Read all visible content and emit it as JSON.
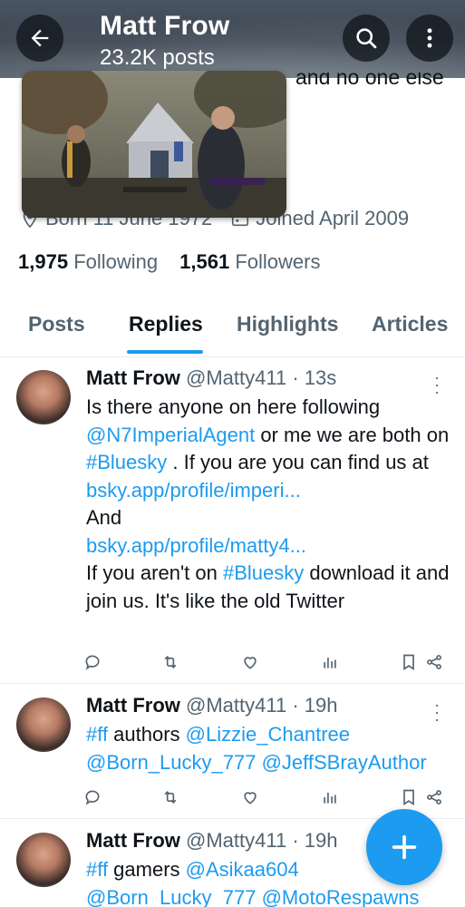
{
  "header": {
    "title": "Matt Frow",
    "post_count": "23.2K posts"
  },
  "bio": {
    "partial_line": "and no one else",
    "born": "Born 11 June 1972",
    "joined": "Joined April 2009"
  },
  "stats": {
    "following_count": "1,975",
    "following_label": "Following",
    "followers_count": "1,561",
    "followers_label": "Followers"
  },
  "tabs": [
    {
      "label": "Posts",
      "active": false
    },
    {
      "label": "Replies",
      "active": true
    },
    {
      "label": "Highlights",
      "active": false
    },
    {
      "label": "Articles",
      "active": false
    }
  ],
  "posts": [
    {
      "name": "Matt Frow",
      "handle": "@Matty411",
      "time": "· 13s",
      "body": {
        "t1": "Is there anyone on here following ",
        "l1": "@N7ImperialAgent",
        "t2": " or me we are both on ",
        "l2": "#Bluesky",
        "t3": " . If you are you can find us at",
        "l3": "bsky.app/profile/imperi...",
        "t4": "And",
        "l4": "bsky.app/profile/matty4...",
        "t5": "If you aren't on ",
        "l5": "#Bluesky",
        "t6": " download it and join us. It's like the old Twitter"
      }
    },
    {
      "name": "Matt Frow",
      "handle": "@Matty411",
      "time": "· 19h",
      "body": {
        "l1": "#ff",
        "t1": " authors ",
        "l2": "@Lizzie_Chantree",
        "l3": "@Born_Lucky_777",
        "l4": "@JeffSBrayAuthor"
      }
    },
    {
      "name": "Matt Frow",
      "handle": "@Matty411",
      "time": "· 19h",
      "body": {
        "l1": "#ff",
        "t1": " gamers ",
        "l2": "@Asikaa604",
        "l3": "@Born_Lucky_777",
        "l4": "@MotoRespawns"
      }
    }
  ],
  "colors": {
    "accent": "#1d9bf0",
    "text_primary": "#0f1419",
    "text_secondary": "#536471"
  },
  "icons": [
    "back-arrow-icon",
    "search-icon",
    "more-vertical-icon",
    "location-icon",
    "calendar-icon",
    "reply-icon",
    "repost-icon",
    "like-icon",
    "views-icon",
    "bookmark-icon",
    "share-icon",
    "compose-plus-icon"
  ]
}
